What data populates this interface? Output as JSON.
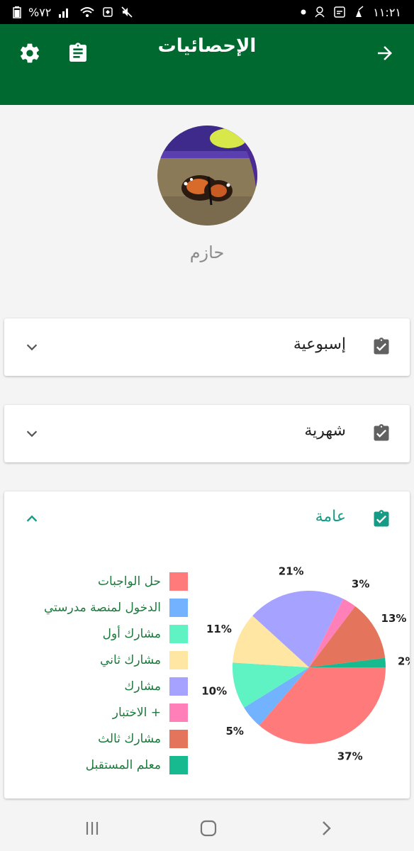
{
  "status_bar": {
    "battery": "%٧٢",
    "time": "١١:٢١"
  },
  "app_bar": {
    "title": "الإحصائيات"
  },
  "profile": {
    "name": "حازم"
  },
  "cards": {
    "weekly": {
      "label": "إسبوعية"
    },
    "monthly": {
      "label": "شهرية"
    },
    "general": {
      "label": "عامة"
    }
  },
  "colors": {
    "app_bar": "#00692f",
    "accent": "#169b86",
    "legend_text": "#1c7a3c"
  },
  "chart_data": {
    "type": "pie",
    "series": [
      {
        "name": "حل الواجبات",
        "value": 37,
        "label": "37%",
        "color": "#ff7b7b"
      },
      {
        "name": "الدخول لمنصة مدرستي",
        "value": 5,
        "label": "5%",
        "color": "#72b2ff"
      },
      {
        "name": "مشارك أول",
        "value": 10,
        "label": "10%",
        "color": "#5ff2c2"
      },
      {
        "name": "مشارك ثاني",
        "value": 11,
        "label": "11%",
        "color": "#ffe6a3"
      },
      {
        "name": "مشارك",
        "value": 21,
        "label": "21%",
        "color": "#a6a2ff"
      },
      {
        "name": "الاختبار +",
        "value": 3,
        "label": "3%",
        "color": "#ff80b8"
      },
      {
        "name": "مشارك ثالث",
        "value": 13,
        "label": "13%",
        "color": "#e4745b"
      },
      {
        "name": "معلم المستقبل",
        "value": 2,
        "label": "2%",
        "color": "#17b98f"
      }
    ],
    "legend_position": "left"
  }
}
